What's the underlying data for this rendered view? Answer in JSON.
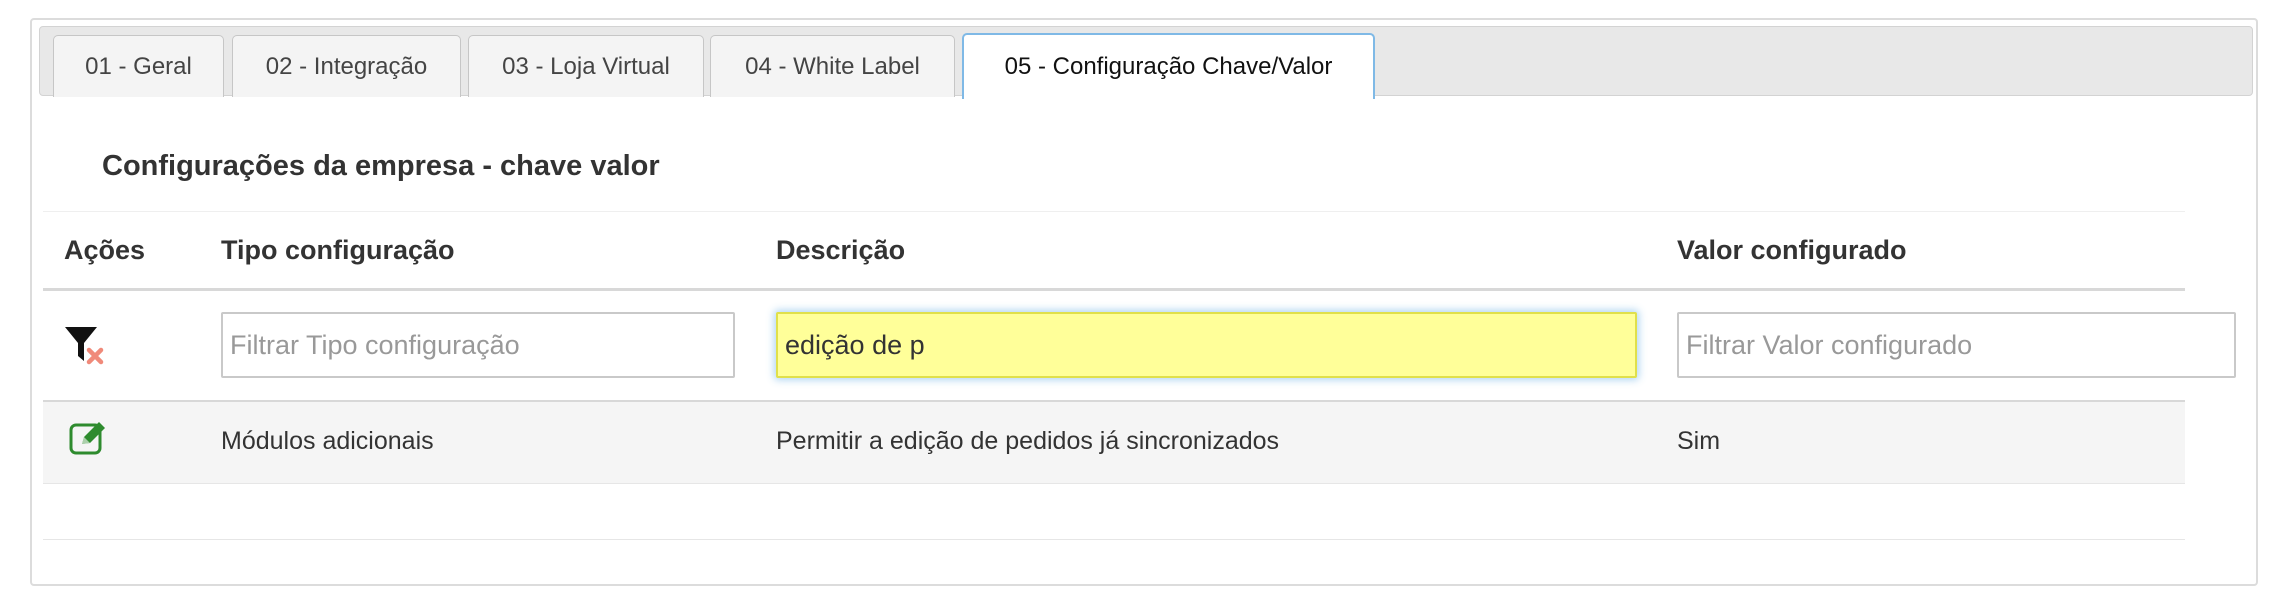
{
  "tabs": [
    {
      "label": "01 - Geral"
    },
    {
      "label": "02 - Integração"
    },
    {
      "label": "03 - Loja Virtual"
    },
    {
      "label": "04 - White Label"
    },
    {
      "label": "05 - Configuração Chave/Valor",
      "active": true
    }
  ],
  "section": {
    "title": "Configurações da empresa - chave valor"
  },
  "table": {
    "headers": {
      "actions": "Ações",
      "type": "Tipo configuração",
      "description": "Descrição",
      "value": "Valor configurado"
    },
    "filters": {
      "type_placeholder": "Filtrar Tipo configuração",
      "type_value": "",
      "description_value": "edição de p",
      "value_placeholder": "Filtrar Valor configurado",
      "value_value": ""
    },
    "rows": [
      {
        "type": "Módulos adicionais",
        "description": "Permitir a edição de pedidos já sincronizados",
        "value": "Sim"
      }
    ]
  },
  "icons": {
    "clear_filter": "filter-clear-icon",
    "edit": "edit-icon"
  },
  "colors": {
    "active_tab_border": "#7fb9e6",
    "filter_highlight": "#ffff99",
    "edit_icon": "#2e8b2e",
    "clear_x": "#f08a7a"
  }
}
